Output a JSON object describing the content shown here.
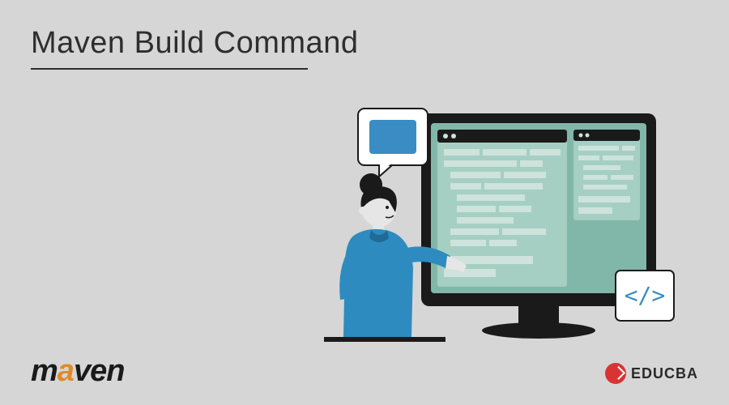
{
  "title": "Maven Build Command",
  "logos": {
    "maven": {
      "m": "m",
      "a": "a",
      "rest": "ven"
    },
    "educba": "EDUCBA"
  },
  "illustration": {
    "desc": "Person pointing at computer monitor showing code window",
    "colors": {
      "monitor_bg": "#81b7a8",
      "window_bg": "#a5cfc2",
      "bar_light": "#cde3db",
      "accent_blue": "#3a8cc4",
      "person_blue": "#2e8bc0",
      "person_dark": "#1a1a1a",
      "skin": "#e6e6e6"
    }
  }
}
